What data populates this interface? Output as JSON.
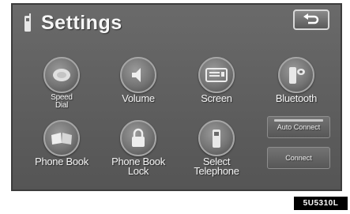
{
  "header": {
    "title": "Settings",
    "back_icon": "back-arrow-icon"
  },
  "menu": {
    "items": [
      {
        "id": "speed-dial",
        "label_lines": [
          "Speed",
          "Dial"
        ],
        "icon": "speed-dial-icon"
      },
      {
        "id": "volume",
        "label_lines": [
          "Volume"
        ],
        "icon": "volume-icon"
      },
      {
        "id": "screen",
        "label_lines": [
          "Screen"
        ],
        "icon": "screen-icon"
      },
      {
        "id": "bluetooth",
        "label_lines": [
          "Bluetooth"
        ],
        "icon": "bluetooth-phone-icon"
      },
      {
        "id": "phone-book",
        "label_lines": [
          "Phone Book"
        ],
        "icon": "phone-book-icon"
      },
      {
        "id": "phone-book-lock",
        "label_lines": [
          "Phone Book",
          "Lock"
        ],
        "icon": "padlock-icon"
      },
      {
        "id": "select-telephone",
        "label_lines": [
          "Select",
          "Telephone"
        ],
        "icon": "telephone-handset-icon"
      }
    ]
  },
  "side_buttons": {
    "auto_connect": "Auto Connect",
    "connect": "Connect"
  },
  "watermark": "5U5310L",
  "colors": {
    "screen_bg": "#5e5e5e",
    "text": "#f4f4f4",
    "frame": "#3c3c3c"
  }
}
